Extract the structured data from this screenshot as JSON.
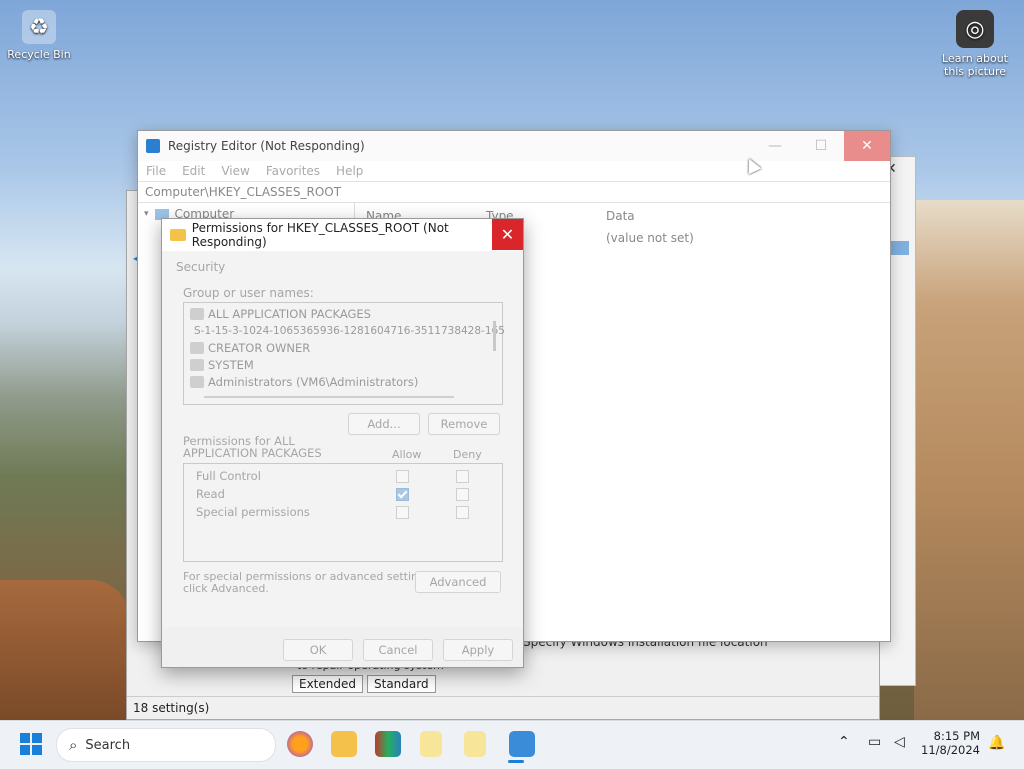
{
  "desktop": {
    "recycle_bin": "Recycle Bin",
    "learn_picture_line1": "Learn about",
    "learn_picture_line2": "this picture"
  },
  "back_window": {
    "status": "18 setting(s)",
    "tab_extended": "Extended",
    "tab_standard": "Standard",
    "line_text": "Specify Windows installation file location",
    "line_text2": "to repair operating system"
  },
  "regedit": {
    "title": "Registry Editor (Not Responding)",
    "menu": [
      "File",
      "Edit",
      "View",
      "Favorites",
      "Help"
    ],
    "address": "Computer\\HKEY_CLASSES_ROOT",
    "tree_root": "Computer",
    "col_name": "Name",
    "col_type": "Type",
    "col_data": "Data",
    "value_data": "(value not set)"
  },
  "dialog": {
    "title": "Permissions for HKEY_CLASSES_ROOT (Not Responding)",
    "tab": "Security",
    "group_label": "Group or user names:",
    "users": [
      "ALL APPLICATION PACKAGES",
      "S-1-15-3-1024-1065365936-1281604716-3511738428-165",
      "CREATOR OWNER",
      "SYSTEM",
      "Administrators (VM6\\Administrators)"
    ],
    "add": "Add...",
    "remove": "Remove",
    "perm_label_line1": "Permissions for ALL",
    "perm_label_line2": "APPLICATION PACKAGES",
    "allow": "Allow",
    "deny": "Deny",
    "permissions": [
      {
        "name": "Full Control",
        "allow": false,
        "deny": false
      },
      {
        "name": "Read",
        "allow": true,
        "deny": false
      },
      {
        "name": "Special permissions",
        "allow": false,
        "deny": false
      }
    ],
    "special_line1": "For special permissions or advanced settings,",
    "special_line2": "click Advanced.",
    "advanced": "Advanced",
    "ok": "OK",
    "cancel": "Cancel",
    "apply": "Apply"
  },
  "taskbar": {
    "search_placeholder": "Search",
    "time": "8:15 PM",
    "date": "11/8/2024"
  },
  "colors": {
    "close_red": "#d9262b",
    "taskbar_bg": "#eef2f6",
    "folder_yellow": "#f4c14b"
  }
}
